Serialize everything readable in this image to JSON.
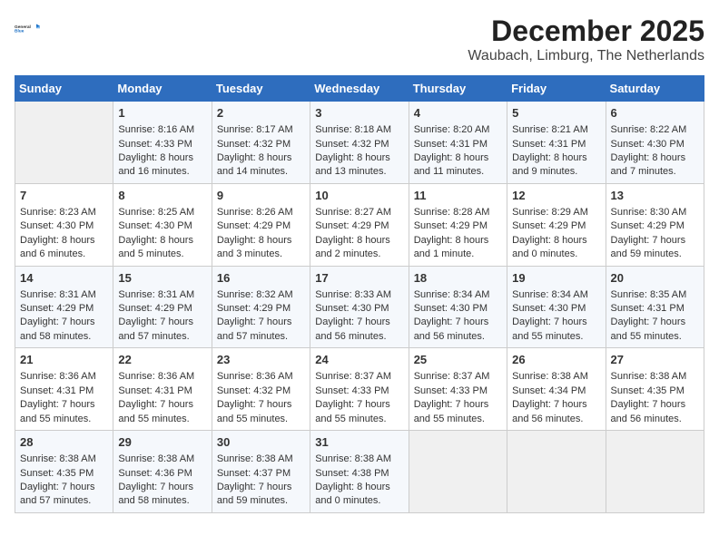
{
  "header": {
    "logo_text_general": "General",
    "logo_text_blue": "Blue",
    "title": "December 2025",
    "subtitle": "Waubach, Limburg, The Netherlands"
  },
  "calendar": {
    "days_of_week": [
      "Sunday",
      "Monday",
      "Tuesday",
      "Wednesday",
      "Thursday",
      "Friday",
      "Saturday"
    ],
    "weeks": [
      [
        {
          "day": "",
          "info": ""
        },
        {
          "day": "1",
          "info": "Sunrise: 8:16 AM\nSunset: 4:33 PM\nDaylight: 8 hours\nand 16 minutes."
        },
        {
          "day": "2",
          "info": "Sunrise: 8:17 AM\nSunset: 4:32 PM\nDaylight: 8 hours\nand 14 minutes."
        },
        {
          "day": "3",
          "info": "Sunrise: 8:18 AM\nSunset: 4:32 PM\nDaylight: 8 hours\nand 13 minutes."
        },
        {
          "day": "4",
          "info": "Sunrise: 8:20 AM\nSunset: 4:31 PM\nDaylight: 8 hours\nand 11 minutes."
        },
        {
          "day": "5",
          "info": "Sunrise: 8:21 AM\nSunset: 4:31 PM\nDaylight: 8 hours\nand 9 minutes."
        },
        {
          "day": "6",
          "info": "Sunrise: 8:22 AM\nSunset: 4:30 PM\nDaylight: 8 hours\nand 7 minutes."
        }
      ],
      [
        {
          "day": "7",
          "info": "Sunrise: 8:23 AM\nSunset: 4:30 PM\nDaylight: 8 hours\nand 6 minutes."
        },
        {
          "day": "8",
          "info": "Sunrise: 8:25 AM\nSunset: 4:30 PM\nDaylight: 8 hours\nand 5 minutes."
        },
        {
          "day": "9",
          "info": "Sunrise: 8:26 AM\nSunset: 4:29 PM\nDaylight: 8 hours\nand 3 minutes."
        },
        {
          "day": "10",
          "info": "Sunrise: 8:27 AM\nSunset: 4:29 PM\nDaylight: 8 hours\nand 2 minutes."
        },
        {
          "day": "11",
          "info": "Sunrise: 8:28 AM\nSunset: 4:29 PM\nDaylight: 8 hours\nand 1 minute."
        },
        {
          "day": "12",
          "info": "Sunrise: 8:29 AM\nSunset: 4:29 PM\nDaylight: 8 hours\nand 0 minutes."
        },
        {
          "day": "13",
          "info": "Sunrise: 8:30 AM\nSunset: 4:29 PM\nDaylight: 7 hours\nand 59 minutes."
        }
      ],
      [
        {
          "day": "14",
          "info": "Sunrise: 8:31 AM\nSunset: 4:29 PM\nDaylight: 7 hours\nand 58 minutes."
        },
        {
          "day": "15",
          "info": "Sunrise: 8:31 AM\nSunset: 4:29 PM\nDaylight: 7 hours\nand 57 minutes."
        },
        {
          "day": "16",
          "info": "Sunrise: 8:32 AM\nSunset: 4:29 PM\nDaylight: 7 hours\nand 57 minutes."
        },
        {
          "day": "17",
          "info": "Sunrise: 8:33 AM\nSunset: 4:30 PM\nDaylight: 7 hours\nand 56 minutes."
        },
        {
          "day": "18",
          "info": "Sunrise: 8:34 AM\nSunset: 4:30 PM\nDaylight: 7 hours\nand 56 minutes."
        },
        {
          "day": "19",
          "info": "Sunrise: 8:34 AM\nSunset: 4:30 PM\nDaylight: 7 hours\nand 55 minutes."
        },
        {
          "day": "20",
          "info": "Sunrise: 8:35 AM\nSunset: 4:31 PM\nDaylight: 7 hours\nand 55 minutes."
        }
      ],
      [
        {
          "day": "21",
          "info": "Sunrise: 8:36 AM\nSunset: 4:31 PM\nDaylight: 7 hours\nand 55 minutes."
        },
        {
          "day": "22",
          "info": "Sunrise: 8:36 AM\nSunset: 4:31 PM\nDaylight: 7 hours\nand 55 minutes."
        },
        {
          "day": "23",
          "info": "Sunrise: 8:36 AM\nSunset: 4:32 PM\nDaylight: 7 hours\nand 55 minutes."
        },
        {
          "day": "24",
          "info": "Sunrise: 8:37 AM\nSunset: 4:33 PM\nDaylight: 7 hours\nand 55 minutes."
        },
        {
          "day": "25",
          "info": "Sunrise: 8:37 AM\nSunset: 4:33 PM\nDaylight: 7 hours\nand 55 minutes."
        },
        {
          "day": "26",
          "info": "Sunrise: 8:38 AM\nSunset: 4:34 PM\nDaylight: 7 hours\nand 56 minutes."
        },
        {
          "day": "27",
          "info": "Sunrise: 8:38 AM\nSunset: 4:35 PM\nDaylight: 7 hours\nand 56 minutes."
        }
      ],
      [
        {
          "day": "28",
          "info": "Sunrise: 8:38 AM\nSunset: 4:35 PM\nDaylight: 7 hours\nand 57 minutes."
        },
        {
          "day": "29",
          "info": "Sunrise: 8:38 AM\nSunset: 4:36 PM\nDaylight: 7 hours\nand 58 minutes."
        },
        {
          "day": "30",
          "info": "Sunrise: 8:38 AM\nSunset: 4:37 PM\nDaylight: 7 hours\nand 59 minutes."
        },
        {
          "day": "31",
          "info": "Sunrise: 8:38 AM\nSunset: 4:38 PM\nDaylight: 8 hours\nand 0 minutes."
        },
        {
          "day": "",
          "info": ""
        },
        {
          "day": "",
          "info": ""
        },
        {
          "day": "",
          "info": ""
        }
      ]
    ]
  }
}
